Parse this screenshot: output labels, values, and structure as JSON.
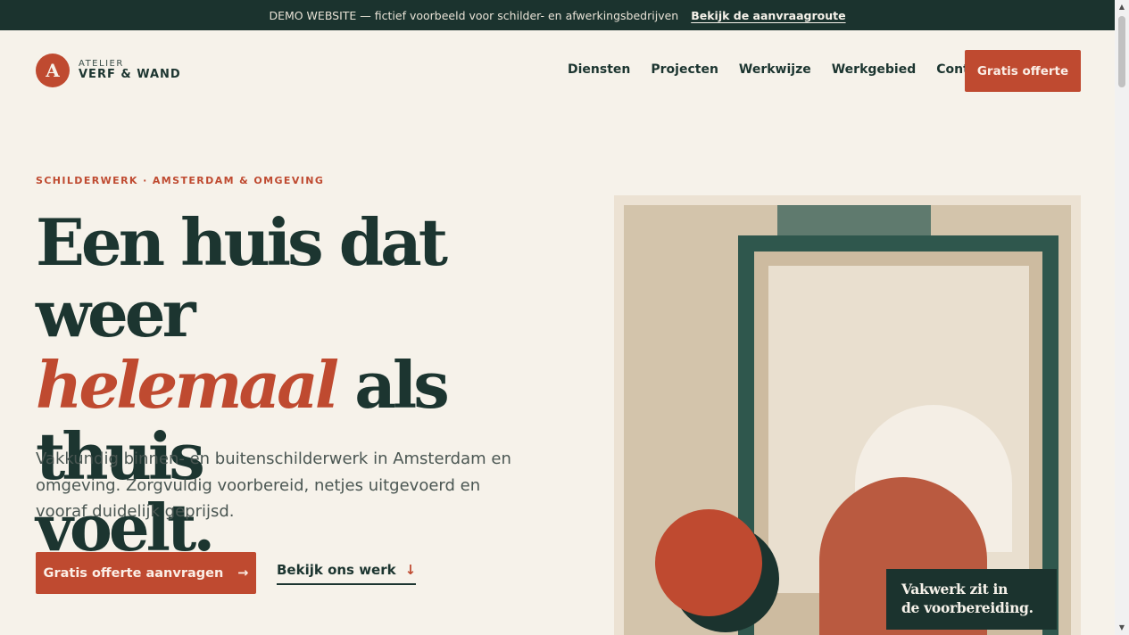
{
  "topbar": {
    "text": "DEMO WEBSITE — fictief voorbeeld voor schilder- en afwerkingsbedrijven",
    "link": "Bekijk de aanvraagroute"
  },
  "brand": {
    "initial": "A",
    "line1": "ATELIER",
    "line2": "VERF & WAND"
  },
  "nav": {
    "items": [
      "Diensten",
      "Projecten",
      "Werkwijze",
      "Werkgebied",
      "Contact"
    ],
    "cta": "Gratis offerte"
  },
  "hero": {
    "eyebrow": "SCHILDERWERK · AMSTERDAM & OMGEVING",
    "line1": "Een huis dat weer",
    "accent": "helemaal",
    "line2_rest": " als thuis",
    "line3": "voelt.",
    "intro": "Vakkundig binnen- en buitenschilderwerk in Amsterdam en omgeving. Zorgvuldig voorbereid, netjes uitgevoerd en vooraf duidelijk geprijsd.",
    "primary_button": "Gratis offerte aanvragen",
    "primary_arrow": "→",
    "secondary_link": "Bekijk ons werk",
    "secondary_arrow": "↓",
    "badge_line1": "Vakwerk zit in",
    "badge_line2": "de voorbereiding."
  },
  "colors": {
    "accent": "#bf4a30",
    "dark": "#1b332e",
    "background": "#f6f2ea"
  }
}
